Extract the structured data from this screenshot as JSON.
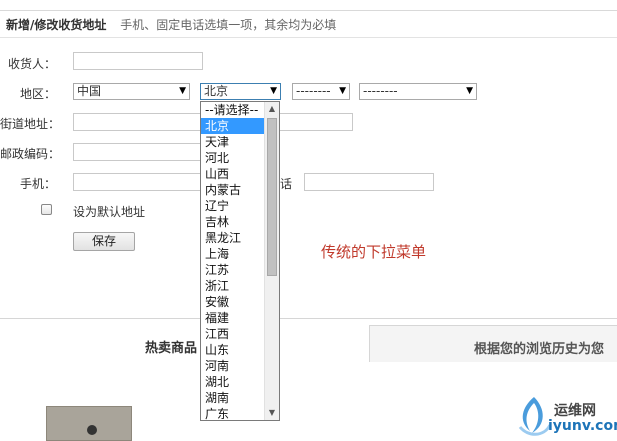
{
  "header": {
    "title": "新增/修改收货地址",
    "hint": "手机、固定电话选填一项，其余均为必填"
  },
  "form": {
    "consignee_label": "收货人：",
    "region_label": "地区：",
    "street_label": "街道地址：",
    "zip_label": "邮政编码：",
    "mobile_label": "手机：",
    "phone_label_fragment": "话",
    "country_value": "中国",
    "province_value": "北京",
    "city_value": "--------",
    "district_value": "--------",
    "default_label": "设为默认地址",
    "save_label": "保存"
  },
  "dropdown": {
    "options": [
      "--请选择--",
      "北京",
      "天津",
      "河北",
      "山西",
      "内蒙古",
      "辽宁",
      "吉林",
      "黑龙江",
      "上海",
      "江苏",
      "浙江",
      "安徽",
      "福建",
      "江西",
      "山东",
      "河南",
      "湖北",
      "湖南",
      "广东"
    ],
    "selected_index": 1
  },
  "annotation": "传统的下拉菜单",
  "tabs": {
    "hot": "热卖商品",
    "history": "根据您的浏览历史为您"
  },
  "logo": {
    "line1": "运维网",
    "line2": "iyunv.com"
  },
  "icons": {
    "dropdown_arrow": "dropdown-arrow-icon",
    "scroll_up": "scroll-up-icon",
    "scroll_down": "scroll-down-icon"
  },
  "colors": {
    "selected_bg": "#3399ff",
    "annotation": "#c0392b",
    "logo_blue": "#1d74b8"
  }
}
